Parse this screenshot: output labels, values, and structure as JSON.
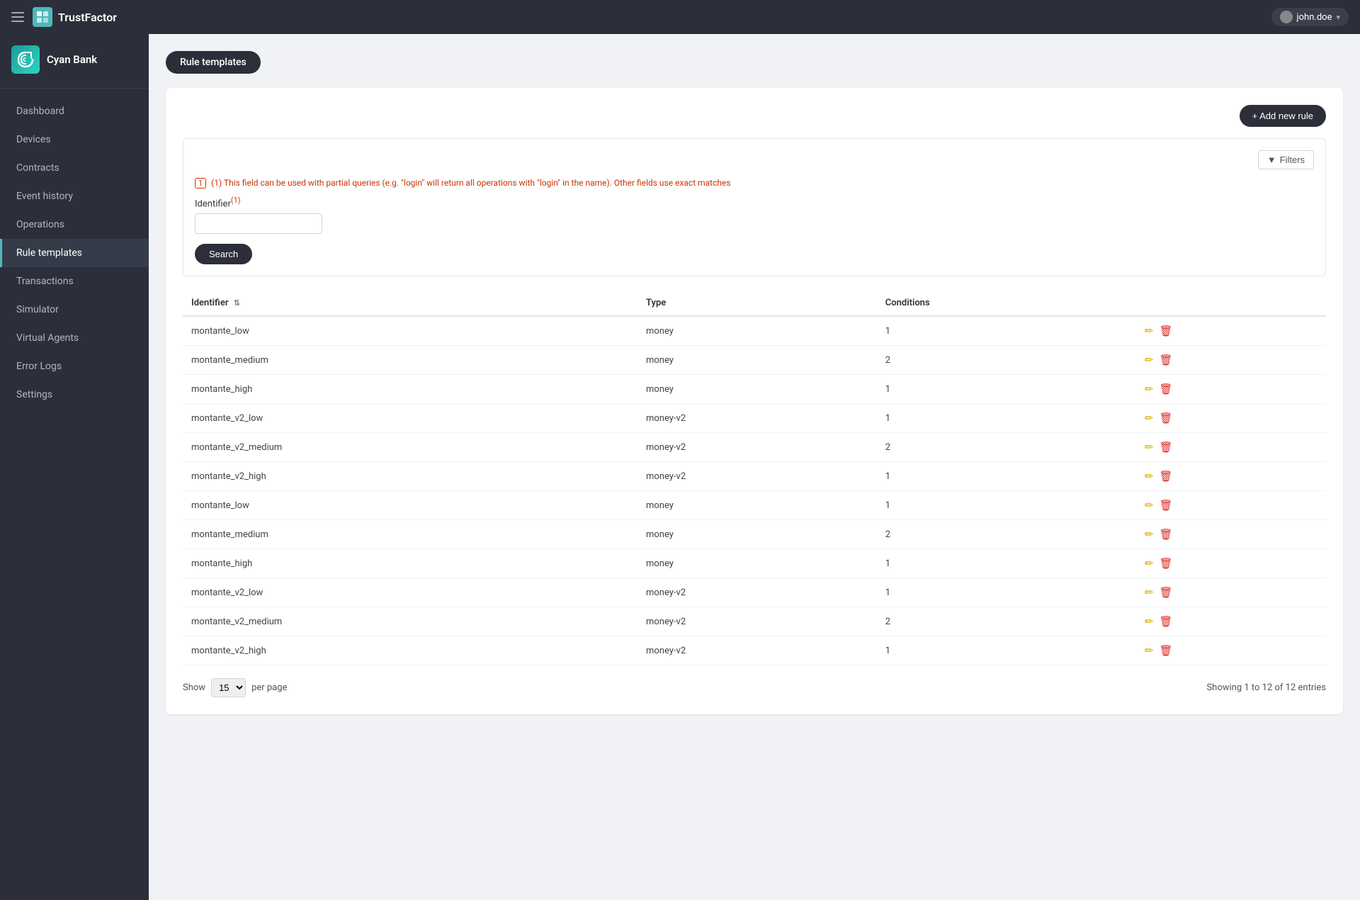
{
  "topbar": {
    "app_name": "TrustFactor",
    "user_label": "john.doe"
  },
  "sidebar": {
    "brand_name": "Cyan Bank",
    "nav_items": [
      {
        "id": "dashboard",
        "label": "Dashboard",
        "active": false
      },
      {
        "id": "devices",
        "label": "Devices",
        "active": false
      },
      {
        "id": "contracts",
        "label": "Contracts",
        "active": false
      },
      {
        "id": "event-history",
        "label": "Event history",
        "active": false
      },
      {
        "id": "operations",
        "label": "Operations",
        "active": false
      },
      {
        "id": "rule-templates",
        "label": "Rule templates",
        "active": true
      },
      {
        "id": "transactions",
        "label": "Transactions",
        "active": false
      },
      {
        "id": "simulator",
        "label": "Simulator",
        "active": false
      },
      {
        "id": "virtual-agents",
        "label": "Virtual Agents",
        "active": false
      },
      {
        "id": "error-logs",
        "label": "Error Logs",
        "active": false
      },
      {
        "id": "settings",
        "label": "Settings",
        "active": false
      }
    ]
  },
  "page": {
    "title": "Rule templates",
    "add_button_label": "+ Add new rule",
    "filters_button_label": "Filters",
    "filter_hint": "(1) This field can be used with partial queries (e.g. \"login\" will return all operations with \"login\" in the name). Other fields use exact matches",
    "identifier_label": "Identifier",
    "identifier_sup": "(1)",
    "search_button_label": "Search",
    "table_headers": [
      {
        "label": "Identifier",
        "sortable": true
      },
      {
        "label": "Type",
        "sortable": false
      },
      {
        "label": "Conditions",
        "sortable": false
      },
      {
        "label": "",
        "sortable": false
      }
    ],
    "table_rows": [
      {
        "identifier": "montante_low",
        "type": "money",
        "conditions": "1"
      },
      {
        "identifier": "montante_medium",
        "type": "money",
        "conditions": "2"
      },
      {
        "identifier": "montante_high",
        "type": "money",
        "conditions": "1"
      },
      {
        "identifier": "montante_v2_low",
        "type": "money-v2",
        "conditions": "1"
      },
      {
        "identifier": "montante_v2_medium",
        "type": "money-v2",
        "conditions": "2"
      },
      {
        "identifier": "montante_v2_high",
        "type": "money-v2",
        "conditions": "1"
      },
      {
        "identifier": "montante_low",
        "type": "money",
        "conditions": "1"
      },
      {
        "identifier": "montante_medium",
        "type": "money",
        "conditions": "2"
      },
      {
        "identifier": "montante_high",
        "type": "money",
        "conditions": "1"
      },
      {
        "identifier": "montante_v2_low",
        "type": "money-v2",
        "conditions": "1"
      },
      {
        "identifier": "montante_v2_medium",
        "type": "money-v2",
        "conditions": "2"
      },
      {
        "identifier": "montante_v2_high",
        "type": "money-v2",
        "conditions": "1"
      }
    ],
    "show_label": "Show",
    "per_page_value": "15",
    "per_page_label": "per page",
    "pagination_info": "Showing 1 to 12 of 12 entries"
  }
}
